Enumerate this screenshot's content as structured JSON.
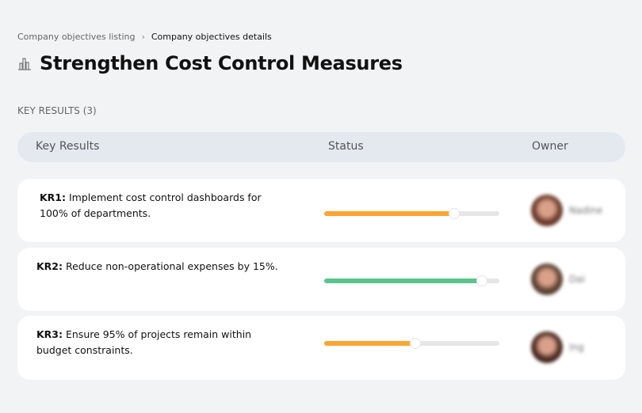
{
  "breadcrumb": {
    "parent": "Company objectives listing",
    "separator": "›",
    "current": "Company objectives details"
  },
  "page": {
    "title": "Strengthen Cost Control Measures",
    "icon": "building-chart-icon"
  },
  "section": {
    "label": "KEY RESULTS (3)"
  },
  "table": {
    "headers": {
      "key_results": "Key Results",
      "status": "Status",
      "owner": "Owner"
    }
  },
  "key_results": [
    {
      "id": "KR1:",
      "text": " Implement cost control dashboards for 100% of departments.",
      "progress": 74,
      "color": "#fda532",
      "owner": "Nadine",
      "avatar_color": "#6b3a2a"
    },
    {
      "id": "KR2:",
      "text": " Reduce non-operational expenses by 15%.",
      "progress": 90,
      "color": "#58c68c",
      "owner": "Dai",
      "avatar_color": "#5a4030"
    },
    {
      "id": "KR3:",
      "text": " Ensure 95% of projects remain within budget constraints.",
      "progress": 52,
      "color": "#fda532",
      "owner": "Ing",
      "avatar_color": "#4a2a22"
    }
  ]
}
